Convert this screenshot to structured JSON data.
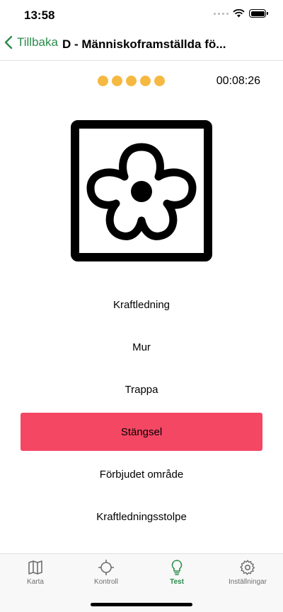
{
  "status": {
    "time": "13:58"
  },
  "nav": {
    "back_label": "Tillbaka",
    "title": "D - Människoframställda fö..."
  },
  "quiz": {
    "progress": {
      "total": 5,
      "dots_color": "#f5b942"
    },
    "timer": "00:08:26",
    "symbol_icon": "flower-in-square-icon",
    "answers": [
      {
        "label": "Kraftledning",
        "selected": false
      },
      {
        "label": "Mur",
        "selected": false
      },
      {
        "label": "Trappa",
        "selected": false
      },
      {
        "label": "Stängsel",
        "selected": true
      },
      {
        "label": "Förbjudet område",
        "selected": false
      },
      {
        "label": "Kraftledningsstolpe",
        "selected": false
      }
    ],
    "selected_color": "#f44763"
  },
  "tabs": [
    {
      "label": "Karta",
      "icon": "map-icon",
      "active": false
    },
    {
      "label": "Kontroll",
      "icon": "crosshair-icon",
      "active": false
    },
    {
      "label": "Test",
      "icon": "lightbulb-icon",
      "active": true
    },
    {
      "label": "Inställningar",
      "icon": "gear-icon",
      "active": false
    }
  ],
  "colors": {
    "accent": "#2a8a4a"
  }
}
